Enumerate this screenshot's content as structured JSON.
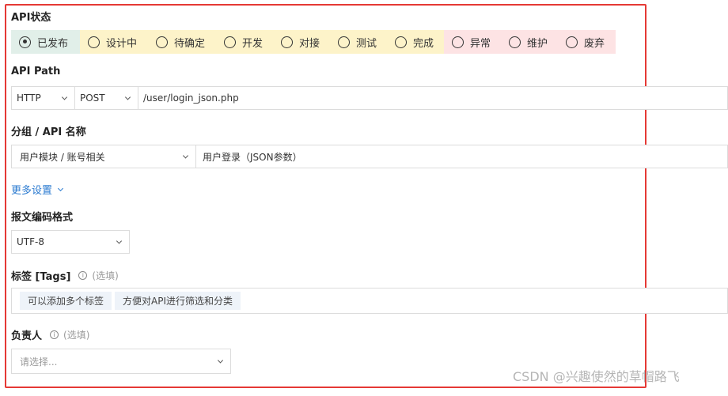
{
  "status": {
    "title": "API状态",
    "items": [
      {
        "label": "已发布",
        "selected": true,
        "tone": "green"
      },
      {
        "label": "设计中",
        "selected": false,
        "tone": "yellow"
      },
      {
        "label": "待确定",
        "selected": false,
        "tone": "yellow"
      },
      {
        "label": "开发",
        "selected": false,
        "tone": "yellow"
      },
      {
        "label": "对接",
        "selected": false,
        "tone": "yellow"
      },
      {
        "label": "测试",
        "selected": false,
        "tone": "yellow"
      },
      {
        "label": "完成",
        "selected": false,
        "tone": "yellow"
      },
      {
        "label": "异常",
        "selected": false,
        "tone": "red"
      },
      {
        "label": "维护",
        "selected": false,
        "tone": "red"
      },
      {
        "label": "废弃",
        "selected": false,
        "tone": "red"
      }
    ]
  },
  "api_path": {
    "title": "API Path",
    "protocol": "HTTP",
    "method": "POST",
    "path": "/user/login_json.php"
  },
  "group_name": {
    "title": "分组 / API 名称",
    "group": "用户模块 / 账号相关",
    "name": "用户登录（JSON参数）"
  },
  "more_settings": "更多设置",
  "encoding": {
    "title": "报文编码格式",
    "value": "UTF-8"
  },
  "tags": {
    "title": "标签 [Tags]",
    "optional": "(选填)",
    "items": [
      "可以添加多个标签",
      "方便对API进行筛选和分类"
    ]
  },
  "owner": {
    "title": "负责人",
    "optional": "(选填)",
    "placeholder": "请选择..."
  },
  "watermark": "CSDN @兴趣使然的草帽路飞",
  "colors": {
    "frame": "#e53935",
    "status_green": "#e1efe9",
    "status_yellow": "#fdf3c9",
    "status_red": "#fde3e4",
    "link": "#2a7ad0"
  }
}
